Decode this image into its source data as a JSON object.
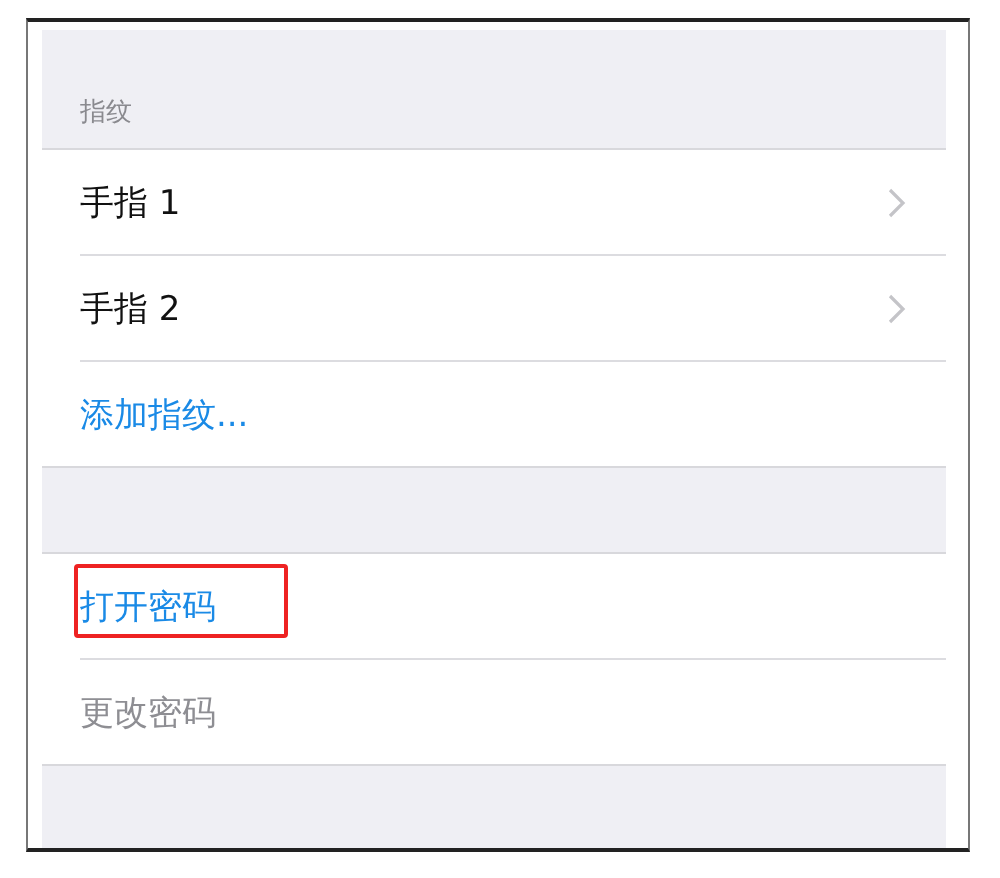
{
  "sections": [
    {
      "header": "指纹",
      "rows": [
        {
          "label": "手指 1",
          "kind": "nav",
          "disabled": false,
          "highlighted": false
        },
        {
          "label": "手指 2",
          "kind": "nav",
          "disabled": false,
          "highlighted": false
        },
        {
          "label": "添加指纹...",
          "kind": "action",
          "disabled": false,
          "highlighted": false
        }
      ]
    },
    {
      "rows": [
        {
          "label": "打开密码",
          "kind": "action",
          "disabled": false,
          "highlighted": true
        },
        {
          "label": "更改密码",
          "kind": "action",
          "disabled": true,
          "highlighted": false
        }
      ]
    }
  ]
}
